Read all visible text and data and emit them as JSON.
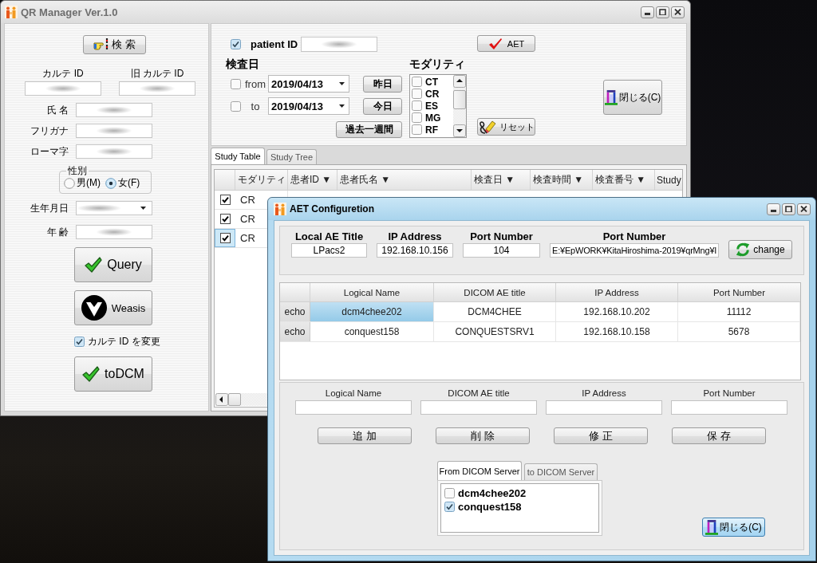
{
  "main_window": {
    "title": "QR Manager Ver.1.0"
  },
  "patient_panel": {
    "search_button": "検 索",
    "id_fields": [
      {
        "label": "カルテ ID",
        "redacted": true
      },
      {
        "label": "旧 カルテ ID",
        "redacted": true
      }
    ],
    "fields": [
      {
        "label": "氏 名",
        "redacted": true
      },
      {
        "label": "フリガナ",
        "redacted": true
      },
      {
        "label": "ローマ字",
        "redacted": true
      }
    ],
    "sex": {
      "label": "性別",
      "options": [
        {
          "label": "男(M)",
          "selected": false
        },
        {
          "label": "女(F)",
          "selected": true
        }
      ]
    },
    "birth_date": {
      "label": "生年月日",
      "redacted": true
    },
    "age": {
      "label": "年 齢",
      "redacted": true
    },
    "actions": [
      {
        "kind": "check_button",
        "label": "Query"
      },
      {
        "kind": "logo_button",
        "label": "Weasis"
      },
      {
        "kind": "checkbox",
        "label": "カルテ ID を変更",
        "checked": true
      },
      {
        "kind": "check_button",
        "label": "toDCM"
      }
    ]
  },
  "search_panel": {
    "patient_id": {
      "label": "patient ID",
      "checked": true,
      "redacted": true
    },
    "aet_button": "AET",
    "date_label": "検査日",
    "date_ranges": [
      {
        "label": "from",
        "checked": false,
        "value": "2019/04/13",
        "button": "昨日"
      },
      {
        "label": "to",
        "checked": false,
        "value": "2019/04/13",
        "button": "今日"
      }
    ],
    "past_week_button": "過去一週間",
    "modality": {
      "label": "モダリティ",
      "items": [
        {
          "label": "CT",
          "checked": false
        },
        {
          "label": "CR",
          "checked": false
        },
        {
          "label": "ES",
          "checked": false
        },
        {
          "label": "MG",
          "checked": false
        },
        {
          "label": "RF",
          "checked": false
        }
      ]
    },
    "reset_button": "リセット",
    "close_button": "閉じる(C)"
  },
  "study_tabs": [
    {
      "label": "Study Table",
      "selected": true
    },
    {
      "label": "Study Tree",
      "selected": false
    }
  ],
  "study_table": {
    "columns": [
      "モダリティ",
      "患者ID ▼",
      "患者氏名 ▼",
      "検査日 ▼",
      "検査時間 ▼",
      "検査番号 ▼",
      "Study"
    ],
    "rows": [
      {
        "checked": true,
        "selected": false,
        "modality": "CR"
      },
      {
        "checked": true,
        "selected": false,
        "modality": "CR"
      },
      {
        "checked": true,
        "selected": true,
        "modality": "CR"
      }
    ]
  },
  "aet_dialog": {
    "title": "AET Configuretion",
    "local": [
      {
        "label": "Local AE Title",
        "value": "LPacs2"
      },
      {
        "label": "IP Address",
        "value": "192.168.10.156"
      },
      {
        "label": "Port Number",
        "value": "104"
      },
      {
        "label": "Port Number",
        "value": "E:¥EpWORK¥KitaHiroshima-2019¥qrMng¥I"
      }
    ],
    "change_button": "change",
    "servers_table": {
      "columns": [
        "Logical Name",
        "DICOM AE title",
        "IP Address",
        "Port Number"
      ],
      "rows": [
        {
          "action": "echo",
          "selected": true,
          "cells": [
            "dcm4chee202",
            "DCM4CHEE",
            "192.168.10.202",
            "11112"
          ]
        },
        {
          "action": "echo",
          "selected": false,
          "cells": [
            "conquest158",
            "CONQUESTSRV1",
            "192.168.10.158",
            "5678"
          ]
        }
      ]
    },
    "editor_fields": [
      {
        "label": "Logical Name"
      },
      {
        "label": "DICOM AE title"
      },
      {
        "label": "IP Address"
      },
      {
        "label": "Port Number"
      }
    ],
    "editor_buttons": [
      "追 加",
      "削 除",
      "修 正",
      "保 存"
    ],
    "direction_tabs": [
      {
        "label": "From DICOM Server",
        "selected": true
      },
      {
        "label": "to DICOM Server",
        "selected": false
      }
    ],
    "server_checklist": [
      {
        "label": "dcm4chee202",
        "checked": false
      },
      {
        "label": "conquest158",
        "checked": true
      }
    ],
    "close_button": "閉じる(C)"
  }
}
